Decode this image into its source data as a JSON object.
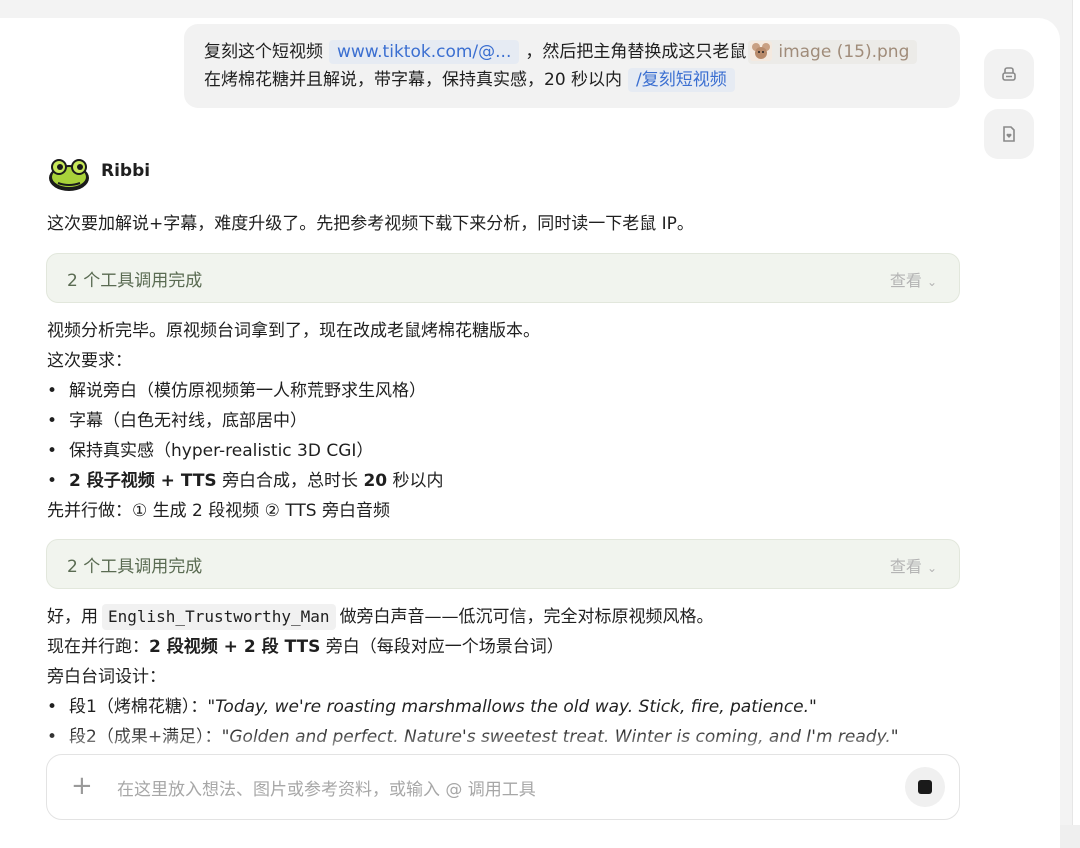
{
  "user_message": {
    "line1_before_link": "复刻这个短视频",
    "link_text": "www.tiktok.com/@...",
    "line1_after_link": "，然后把主角替换成这只老鼠",
    "image_chip": "image (15).png",
    "line2_text": "在烤棉花糖并且解说，带字幕，保持真实感，20 秒以内",
    "skill_chip": "/复刻短视频"
  },
  "assistant": {
    "name": "Ribbi",
    "intro": "这次要加解说+字幕，难度升级了。先把参考视频下载下来分析，同时读一下老鼠 IP。",
    "tool_box_1": {
      "title": "2 个工具调用完成",
      "view": "查看"
    },
    "analysis_done": "视频分析完毕。原视频台词拿到了，现在改成老鼠烤棉花糖版本。",
    "requirements_heading": "这次要求：",
    "requirements": [
      {
        "text": "解说旁白（模仿原视频第一人称荒野求生风格）"
      },
      {
        "text": "字幕（白色无衬线，底部居中）"
      },
      {
        "text": "保持真实感（hyper-realistic 3D CGI）"
      }
    ],
    "req4_part1": "2 段子视频 + TTS",
    "req4_part2": "旁白合成，总时长",
    "req4_part3": "20",
    "req4_part4": "秒以内",
    "parallel_plan": "先并行做：① 生成 2 段视频 ② TTS 旁白音频",
    "tool_box_2": {
      "title": "2 个工具调用完成",
      "view": "查看"
    },
    "voice_before": "好，用",
    "voice_code": "English_Trustworthy_Man",
    "voice_after": "做旁白声音——低沉可信，完全对标原视频风格。",
    "running_prefix": "现在并行跑：",
    "running_bold": "2 段视频 + 2 段 TTS",
    "running_suffix": "旁白（每段对应一个场景台词）",
    "script_heading": "旁白台词设计：",
    "segments": [
      {
        "label": "段1（烤棉花糖）：",
        "quote": "\"Today, we're roasting marshmallows the old way. Stick, fire, patience.\""
      },
      {
        "label": "段2（成果+满足）：",
        "quote": "\"Golden and perfect. Nature's sweetest treat. Winter is coming, and I'm ready.\""
      }
    ]
  },
  "input": {
    "placeholder": "在这里放入想法、图片或参考资料，或输入 @ 调用工具"
  },
  "icons": {
    "side_button_1": "archive-box-icon",
    "side_button_2": "document-heart-icon",
    "plus": "plus-icon",
    "stop": "stop-icon",
    "chevron": "chevron-down-icon"
  },
  "colors": {
    "link_chip_text": "#3b6fd1",
    "tool_box_bg": "#f1f4ee",
    "tool_title": "#5a6b52"
  }
}
